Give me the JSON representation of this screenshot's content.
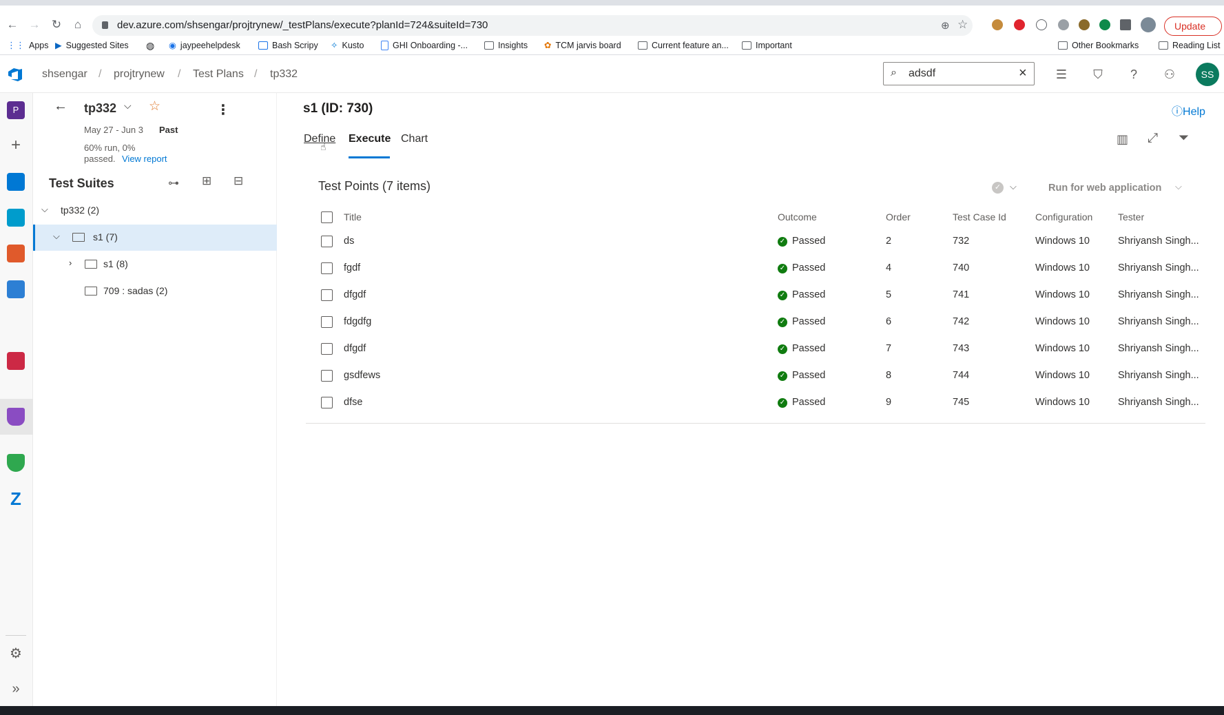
{
  "browser": {
    "url": "dev.azure.com/shsengar/projtrynew/_testPlans/execute?planId=724&suiteId=730",
    "update_label": "Update",
    "bookmarks": [
      {
        "label": "Apps",
        "icon": "apps-grid-icon"
      },
      {
        "label": "Suggested Sites",
        "icon": "bing-icon"
      },
      {
        "label": "",
        "icon": "globe-icon"
      },
      {
        "label": "jaypeehelpdesk",
        "icon": "site-icon"
      },
      {
        "label": "Bash Scripy",
        "icon": "page-icon"
      },
      {
        "label": "Kusto",
        "icon": "kusto-icon"
      },
      {
        "label": "GHI Onboarding -...",
        "icon": "doc-icon"
      },
      {
        "label": "Insights",
        "icon": "folder-icon"
      },
      {
        "label": "TCM jarvis board",
        "icon": "jarvis-icon"
      },
      {
        "label": "Current feature an...",
        "icon": "folder-icon"
      },
      {
        "label": "Important",
        "icon": "folder-icon"
      },
      {
        "label": "Other Bookmarks",
        "icon": "folder-icon"
      },
      {
        "label": "Reading List",
        "icon": "reading-list-icon"
      }
    ]
  },
  "header": {
    "breadcrumbs": [
      "shsengar",
      "projtrynew",
      "Test Plans",
      "tp332"
    ],
    "search_value": "adsdf",
    "avatar_initials": "SS"
  },
  "plan": {
    "name": "tp332",
    "dates": "May 27 - Jun 3",
    "status": "Past",
    "summary_line1": "60% run, 0%",
    "summary_line2": "passed.",
    "view_report": "View report"
  },
  "suites": {
    "title": "Test Suites",
    "items": [
      {
        "label": "tp332 (2)",
        "level": 0,
        "expanded": true
      },
      {
        "label": "s1 (7)",
        "level": 1,
        "expanded": true,
        "selected": true
      },
      {
        "label": "s1 (8)",
        "level": 2,
        "expanded": false
      },
      {
        "label": "709 : sadas (2)",
        "level": 2,
        "expanded": null
      }
    ]
  },
  "main": {
    "title": "s1 (ID: 730)",
    "help": "Help",
    "tabs": [
      {
        "label": "Define",
        "active": false
      },
      {
        "label": "Execute",
        "active": true
      },
      {
        "label": "Chart",
        "active": false
      }
    ],
    "section_title": "Test Points (7 items)",
    "run_label": "Run for web application",
    "columns": [
      "Title",
      "Outcome",
      "Order",
      "Test Case Id",
      "Configuration",
      "Tester"
    ],
    "rows": [
      {
        "title": "ds",
        "outcome": "Passed",
        "order": "2",
        "id": "732",
        "config": "Windows 10",
        "tester": "Shriyansh Singh..."
      },
      {
        "title": "fgdf",
        "outcome": "Passed",
        "order": "4",
        "id": "740",
        "config": "Windows 10",
        "tester": "Shriyansh Singh..."
      },
      {
        "title": "dfgdf",
        "outcome": "Passed",
        "order": "5",
        "id": "741",
        "config": "Windows 10",
        "tester": "Shriyansh Singh..."
      },
      {
        "title": "fdgdfg",
        "outcome": "Passed",
        "order": "6",
        "id": "742",
        "config": "Windows 10",
        "tester": "Shriyansh Singh..."
      },
      {
        "title": "dfgdf",
        "outcome": "Passed",
        "order": "7",
        "id": "743",
        "config": "Windows 10",
        "tester": "Shriyansh Singh..."
      },
      {
        "title": "gsdfews",
        "outcome": "Passed",
        "order": "8",
        "id": "744",
        "config": "Windows 10",
        "tester": "Shriyansh Singh..."
      },
      {
        "title": "dfse",
        "outcome": "Passed",
        "order": "9",
        "id": "745",
        "config": "Windows 10",
        "tester": "Shriyansh Singh..."
      }
    ]
  },
  "colors": {
    "accent": "#0078d4",
    "pass": "#107c10",
    "selected_row": "#deecf9"
  }
}
